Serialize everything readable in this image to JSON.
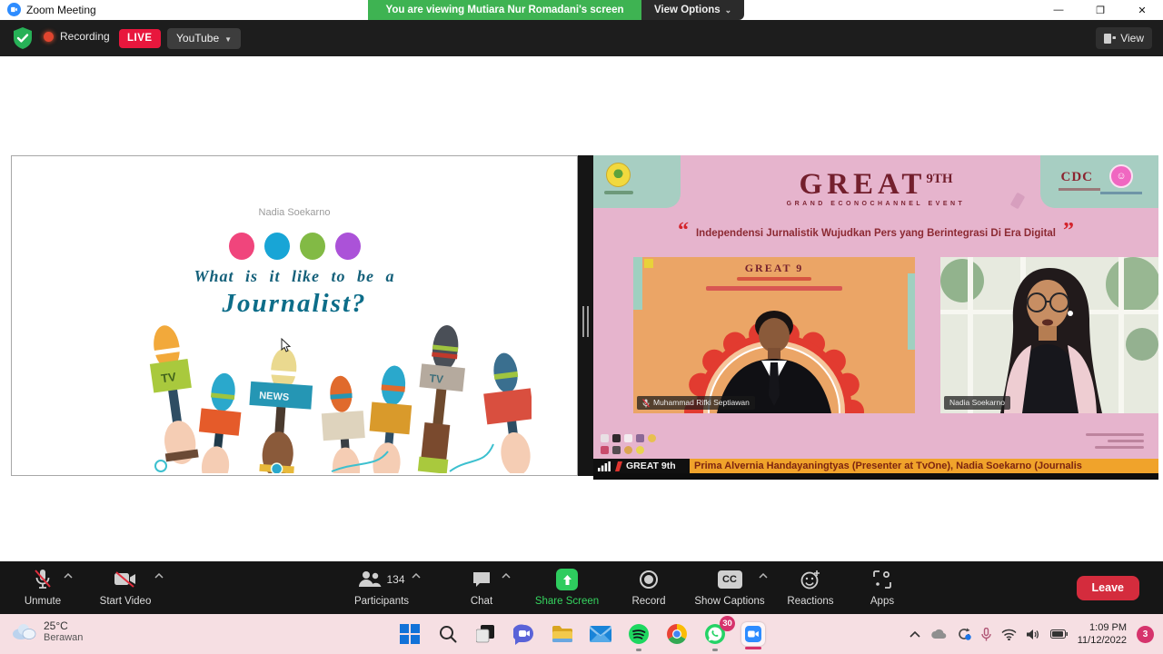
{
  "title_bar": {
    "app_title": "Zoom Meeting",
    "banner_text": "You are viewing Mutiara Nur Romadani's screen",
    "view_options_label": "View Options",
    "minimize": "—",
    "maximize": "❐",
    "close": "✕"
  },
  "control_bar": {
    "recording_label": "Recording",
    "live_label": "LIVE",
    "stream_service": "YouTube",
    "view_label": "View"
  },
  "slide": {
    "presenter_name": "Nadia Soekarno",
    "title_line1": "What is it like to be a",
    "title_line2": "Journalist?",
    "dot_colors": [
      "#f0457c",
      "#18a5d6",
      "#82ba45",
      "#ab52d8"
    ],
    "mic_flag_tv1": "TV",
    "mic_flag_news": "NEWS",
    "mic_flag_tv2": "TV"
  },
  "event_video": {
    "logo_text": "GREAT",
    "logo_sup": "9TH",
    "tagline": "GRAND ECONOCHANNEL EVENT",
    "open_quote": "“",
    "close_quote": "”",
    "quote_text": "Independensi Jurnalistik Wujudkan Pers yang Berintegrasi Di Era Digital",
    "cdc_label": "CDC",
    "speaker_left_name": "Muhammad Rifki Septiawan",
    "speaker_left_mini_logo": "GREAT 9",
    "speaker_right_name": "Nadia Soekarno",
    "ticker_badge": "GREAT 9th",
    "ticker_text": "Prima Alvernia Handayaningtyas (Presenter at TvOne), Nadia Soekarno (Journalis"
  },
  "toolbar": {
    "unmute": "Unmute",
    "start_video": "Start Video",
    "participants": "Participants",
    "participants_count": "134",
    "chat": "Chat",
    "share_screen": "Share Screen",
    "record": "Record",
    "show_captions": "Show Captions",
    "cc_badge": "CC",
    "reactions": "Reactions",
    "apps": "Apps",
    "leave": "Leave"
  },
  "taskbar": {
    "weather_temp": "25°C",
    "weather_desc": "Berawan",
    "whatsapp_badge": "30",
    "clock_time": "1:09 PM",
    "clock_date": "11/12/2022",
    "notification_count": "3"
  },
  "colors": {
    "banner_green": "#3eb352",
    "live_red": "#e8173d",
    "share_green_icon": "#2ecc5e",
    "share_green_text": "#35d55f",
    "leave_red": "#d42c3d",
    "ticker_orange": "#f0a32b",
    "badge_pink": "#d6336c",
    "event_pink": "#e6b4cd",
    "event_maroon": "#731f2d"
  }
}
